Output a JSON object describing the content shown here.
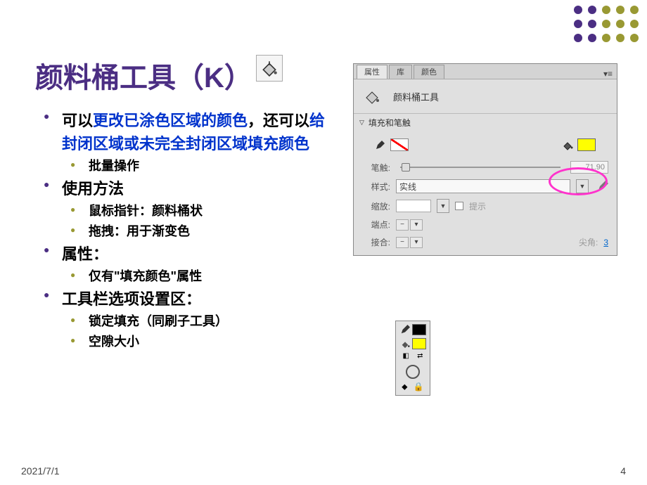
{
  "title": "颜料桶工具（K）",
  "bullets": {
    "b1_pre": "可以",
    "b1_blue1": "更改已涂色区域的颜色",
    "b1_mid": "，还可以",
    "b1_blue2": "给封闭区域或未完全封闭区域填充颜色",
    "b1_sub1": "批量操作",
    "b2": "使用方法",
    "b2_sub1": "鼠标指针：颜料桶状",
    "b2_sub2": "拖拽：用于渐变色",
    "b3": "属性：",
    "b3_sub1": "仅有\"填充颜色\"属性",
    "b4": "工具栏选项设置区：",
    "b4_sub1": "锁定填充（同刷子工具）",
    "b4_sub2": "空隙大小"
  },
  "panel": {
    "tabs": {
      "t1": "属性",
      "t2": "库",
      "t3": "颜色"
    },
    "header_title": "颜料桶工具",
    "section1": "填充和笔触",
    "stroke_label": "笔触:",
    "stroke_value": "71.90",
    "style_label": "样式:",
    "style_value": "实线",
    "scale_label": "缩放:",
    "scale_value": "",
    "hint_label": "提示",
    "cap_label": "端点:",
    "join_label": "接合:",
    "miter_label": "尖角:",
    "miter_value": "3"
  },
  "footer": {
    "date": "2021/7/1",
    "page": "4"
  }
}
